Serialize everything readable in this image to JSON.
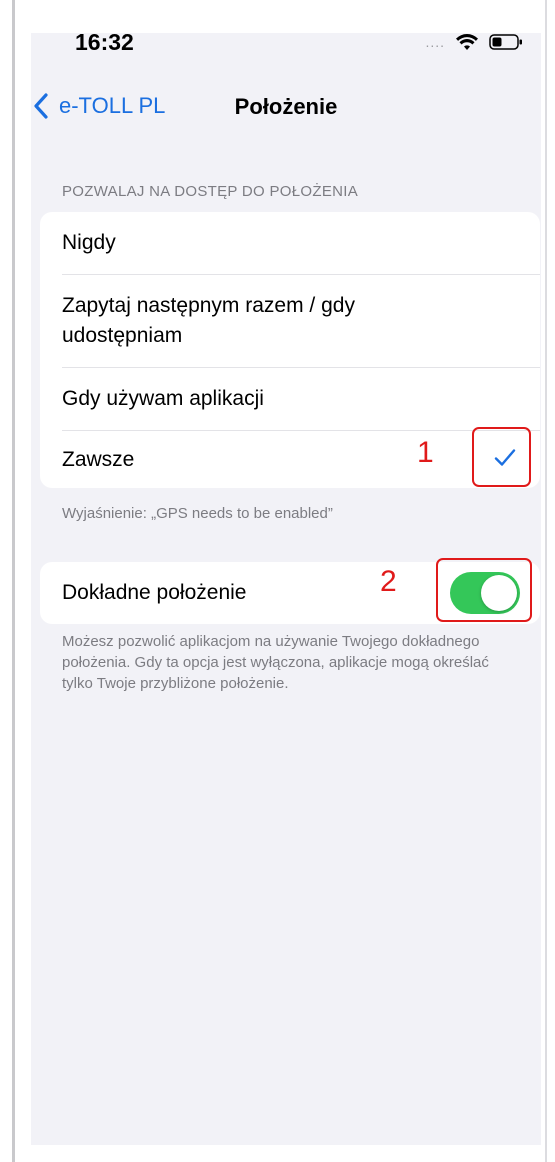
{
  "status_bar": {
    "time": "16:32",
    "signal": "....",
    "wifi_icon": "wifi-icon",
    "battery_icon": "battery-icon"
  },
  "nav": {
    "back_label": "e-TOLL PL",
    "title": "Położenie"
  },
  "location_access": {
    "header": "POZWALAJ NA DOSTĘP DO POŁOŻENIA",
    "options": [
      {
        "label": "Nigdy",
        "selected": false
      },
      {
        "label": "Zapytaj następnym razem / gdy udostępniam",
        "selected": false
      },
      {
        "label": "Gdy używam aplikacji",
        "selected": false
      },
      {
        "label": "Zawsze",
        "selected": true
      }
    ],
    "footer": "Wyjaśnienie: „GPS needs to be enabled”"
  },
  "precise_location": {
    "label": "Dokładne położenie",
    "enabled": true,
    "footer": "Możesz pozwolić aplikacjom na używanie Twojego dokładnego położenia. Gdy ta opcja jest wyłączona, aplikacje mogą określać tylko Twoje przybliżone położenie."
  },
  "annotations": {
    "marker_1": "1",
    "marker_2": "2"
  },
  "colors": {
    "accent": "#1b6fe0",
    "toggle_on": "#34c759",
    "annotation": "#e01a1a",
    "background": "#f2f2f7"
  }
}
